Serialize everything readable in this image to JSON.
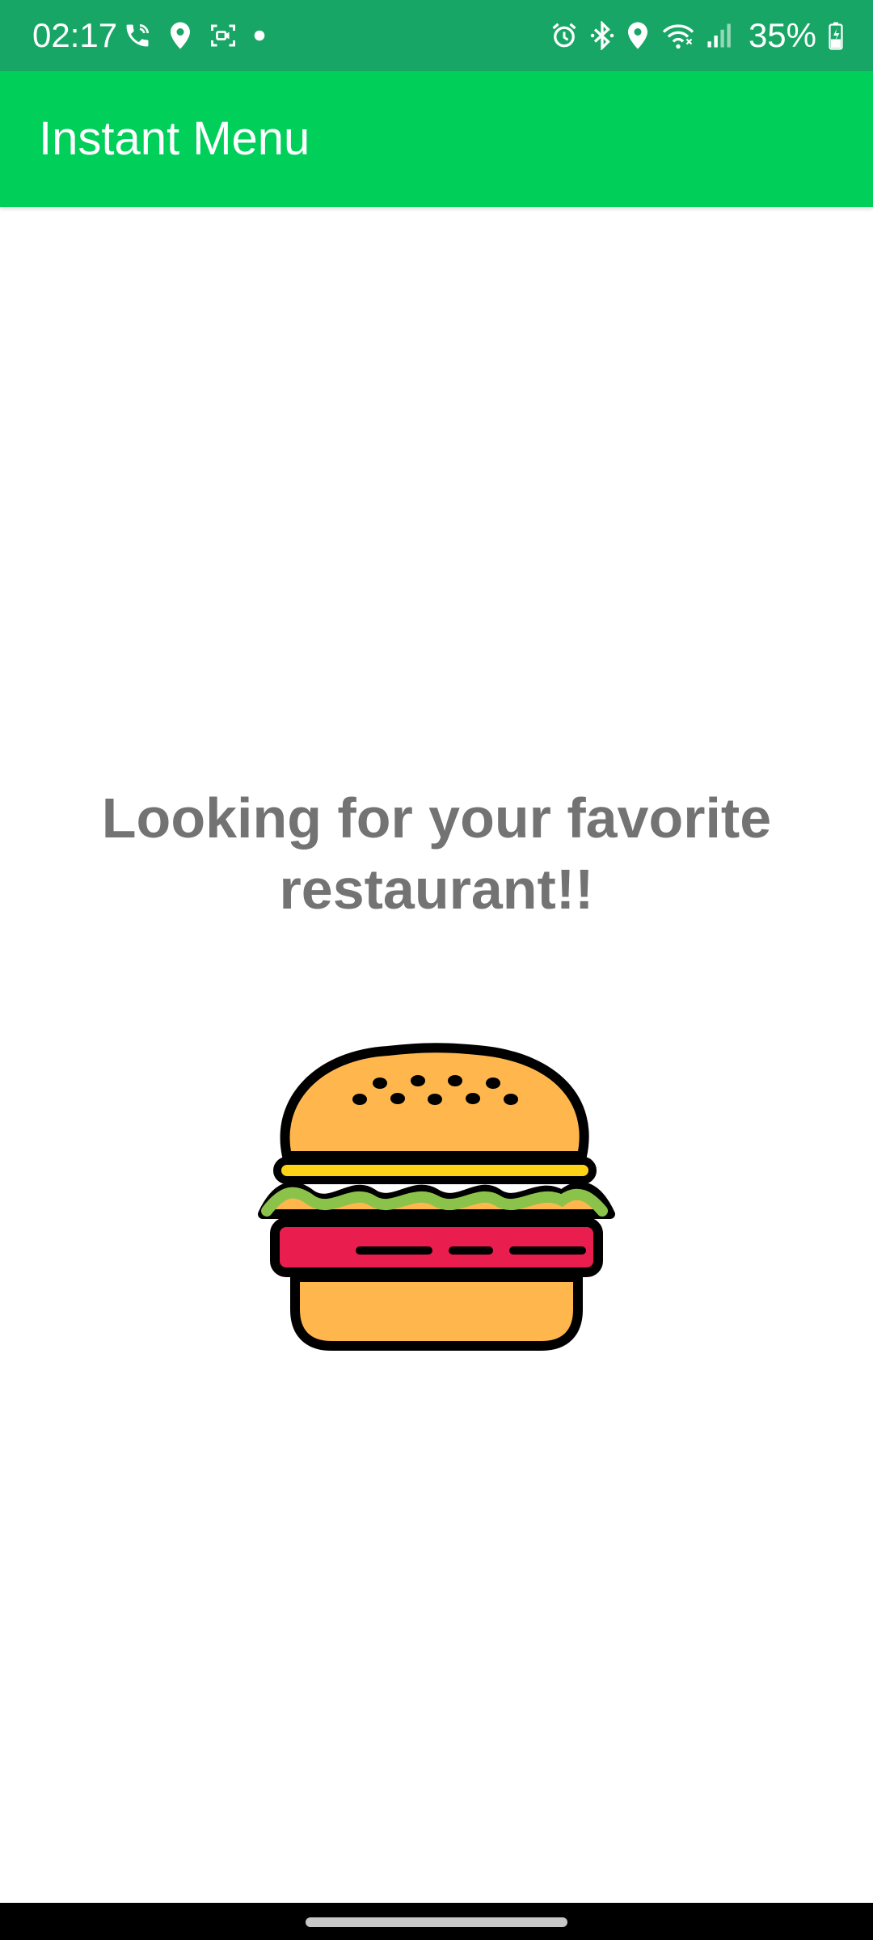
{
  "status_bar": {
    "time": "02:17",
    "battery": "35%",
    "left_icons": [
      "wifi-call-icon",
      "location-icon",
      "screen-record-icon",
      "dot-icon"
    ],
    "right_icons": [
      "alarm-icon",
      "bluetooth-icon",
      "location-icon",
      "wifi-icon",
      "signal-icon",
      "battery-icon"
    ],
    "background": "#17a666"
  },
  "app_bar": {
    "title": "Instant Menu",
    "background": "#00cf5a"
  },
  "main": {
    "message": "Looking for your favorite restaurant!!",
    "illustration": "burger-icon"
  },
  "colors": {
    "bun": "#ffb74d",
    "cheese": "#fdd217",
    "lettuce": "#8bc34a",
    "patty": "#e91e4f",
    "text": "#737373"
  }
}
